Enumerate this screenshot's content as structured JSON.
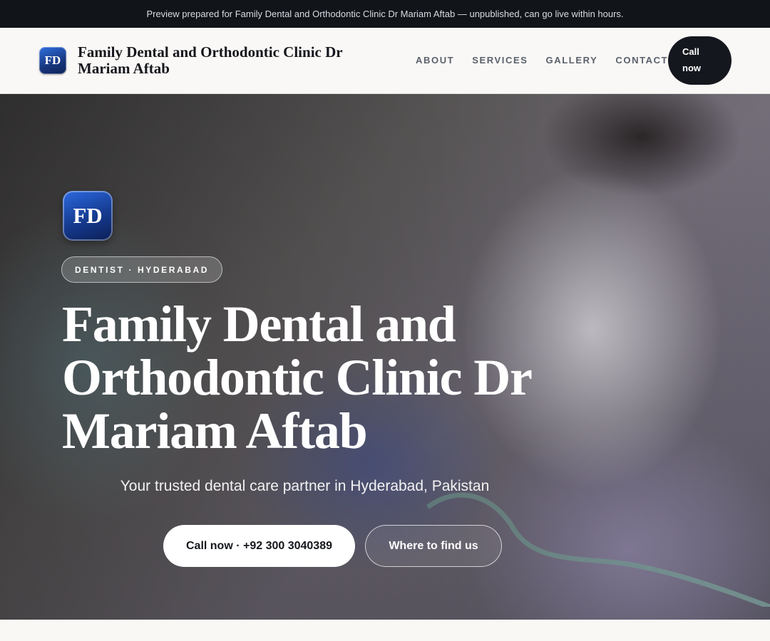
{
  "banner": {
    "text": "Preview prepared for Family Dental and Orthodontic Clinic Dr Mariam Aftab — unpublished, can go live within hours."
  },
  "header": {
    "logo_initials": "FD",
    "brand_name": "Family Dental and Orthodontic Clinic Dr Mariam Aftab",
    "nav": [
      {
        "label": "ABOUT"
      },
      {
        "label": "SERVICES"
      },
      {
        "label": "GALLERY"
      },
      {
        "label": "CONTACT"
      }
    ],
    "call_button": "Call now"
  },
  "hero": {
    "logo_initials": "FD",
    "tagline": "DENTIST · HYDERABAD",
    "title": "Family Dental and Orthodontic Clinic Dr Mariam Aftab",
    "subtitle": "Your trusted dental care partner in Hyderabad, Pakistan",
    "primary_button": "Call now · +92 300 3040389",
    "secondary_button": "Where to find us"
  },
  "colors": {
    "banner_bg": "#111419",
    "header_bg": "#f9f8f6",
    "call_button_bg": "#15171f",
    "logo_blue": "#17367d"
  }
}
